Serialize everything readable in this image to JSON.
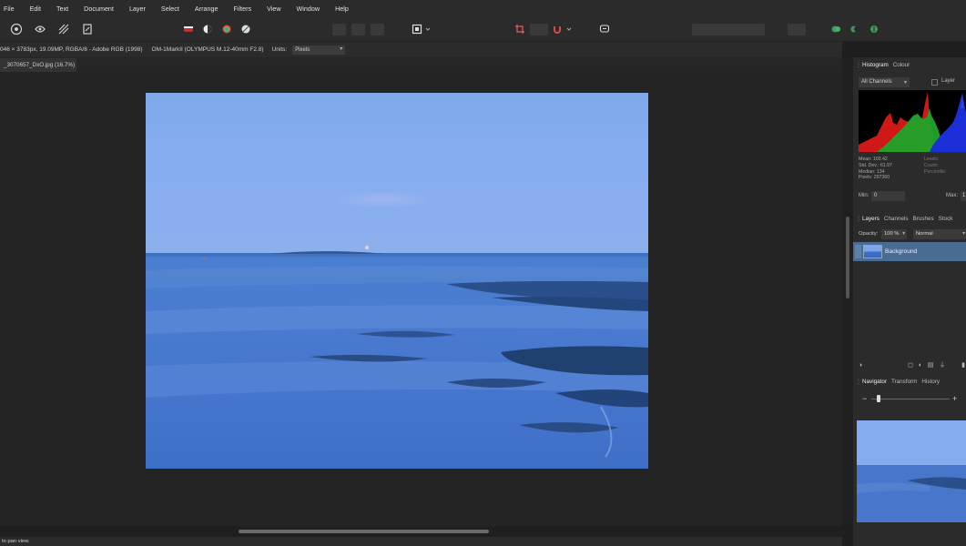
{
  "menu": [
    "File",
    "Edit",
    "Text",
    "Document",
    "Layer",
    "Select",
    "Arrange",
    "Filters",
    "View",
    "Window",
    "Help"
  ],
  "context": {
    "info": "046 × 3783px, 19.09MP, RGBA/8 - Adobe RGB (1998)",
    "camera": "OM-1MarkII (OLYMPUS M.12-40mm F2.8)",
    "units_label": "Units:",
    "units_value": "Pixels"
  },
  "document": {
    "tab_title": "_3070657_DxO.jpg (16.7%)"
  },
  "panels": {
    "histogram": {
      "tabs": [
        "Histogram",
        "Colour"
      ],
      "channel": "All Channels",
      "layer_checkbox": "Layer",
      "stats": [
        "Mean: 103.42",
        "Std. Dev.: 61.97",
        "Median: 134",
        "Pixels: 297360"
      ],
      "stats_right": [
        "Levels:",
        "Count:",
        "Percentile:"
      ],
      "min_label": "Min:",
      "min_value": "0",
      "max_label": "Max:",
      "max_value": "1"
    },
    "layers": {
      "tabs": [
        "Layers",
        "Channels",
        "Brushes",
        "Stock"
      ],
      "opacity_label": "Opacity:",
      "opacity_value": "100 %",
      "blend_mode": "Normal",
      "layer_name": "Background"
    },
    "navigator": {
      "tabs": [
        "Navigator",
        "Transform",
        "History"
      ]
    }
  },
  "status": {
    "text": "to pan view."
  },
  "colors": {
    "accent": "#4a6b92",
    "background": "#1e1e1e",
    "panel": "#2b2b2b"
  }
}
